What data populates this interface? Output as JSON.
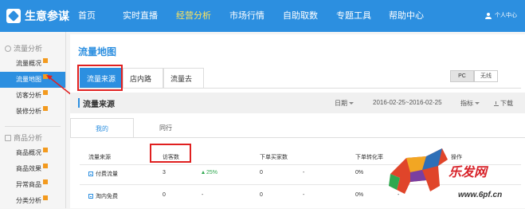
{
  "app": {
    "name": "生意参谋"
  },
  "topnav": {
    "items": [
      "首页",
      "实时直播",
      "经营分析",
      "市场行情",
      "自助取数",
      "专题工具",
      "帮助中心"
    ],
    "active_index": 2,
    "user_label": "个人中心"
  },
  "sidebar": {
    "group1": "流量分析",
    "group1_items": [
      "流量概况",
      "流量地图",
      "访客分析",
      "装修分析"
    ],
    "active_item": "流量地图",
    "group2": "商品分析",
    "group2_items": [
      "商品概况",
      "商品效果",
      "异常商品",
      "分类分析"
    ]
  },
  "main": {
    "title": "流量地图",
    "tabs": [
      "流量来源",
      "店内路径",
      "流量去向"
    ],
    "active_tab": "流量来源",
    "device": {
      "pc": "PC",
      "wireless": "无线",
      "selected": "PC"
    },
    "section": {
      "title": "流量来源",
      "date_label": "日期",
      "date_range": "2016-02-25~2016-02-25",
      "metric_label": "指标",
      "download_label": "下载"
    },
    "subtabs": [
      "我的",
      "同行"
    ],
    "active_subtab": "我的",
    "table": {
      "headers": [
        "流量来源",
        "访客数",
        "下单买家数",
        "下单转化率",
        "操作"
      ],
      "rows": [
        {
          "source": "付费流量",
          "visitors": "3",
          "change": "25%",
          "buyers": "0",
          "buyers_change": "-",
          "conversion": "0%",
          "conversion_change": "-"
        },
        {
          "source": "淘内免费",
          "visitors": "0",
          "change": "-",
          "buyers": "0",
          "buyers_change": "-",
          "conversion": "0%",
          "conversion_change": "-"
        }
      ]
    }
  },
  "watermark": {
    "text": "乐发网",
    "url": "www.6pf.cn"
  },
  "colors": {
    "nav_blue": "#2c8fe0",
    "active_yellow": "#ffe45c",
    "highlight_red": "#e02020",
    "up_green": "#2fa84f"
  }
}
